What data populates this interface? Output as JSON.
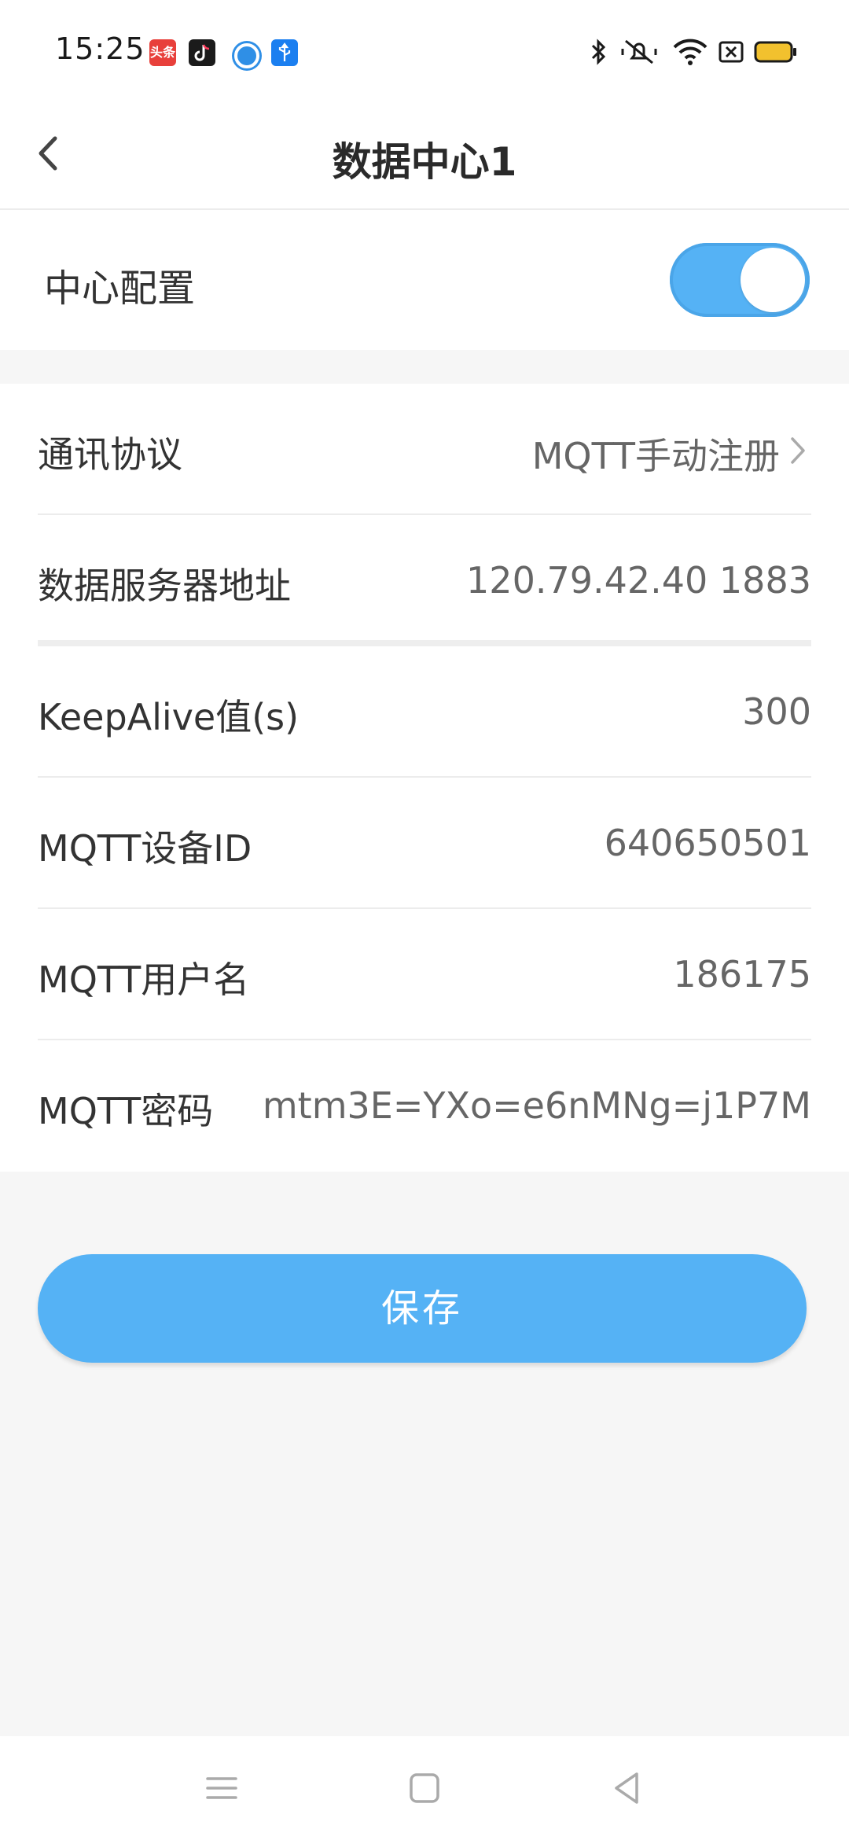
{
  "status_bar": {
    "time": "15:25",
    "notification_icons": [
      "toutiao-app-icon",
      "tiktok-app-icon",
      "circle-app-icon",
      "usb-icon"
    ],
    "status_icons": [
      "bluetooth-icon",
      "mute-icon",
      "wifi-icon",
      "sim-icon",
      "battery-icon"
    ],
    "toutiao_label": "头条"
  },
  "header": {
    "title": "数据中心1",
    "back_icon": "back-arrow-icon"
  },
  "config": {
    "label": "中心配置",
    "enabled": true,
    "accent_color": "#55b2f5"
  },
  "rows": [
    {
      "label": "通讯协议",
      "value": "MQTT手动注册",
      "has_chevron": true
    },
    {
      "label": "数据服务器地址",
      "value": "120.79.42.40 1883",
      "has_chevron": false
    },
    {
      "label": "KeepAlive值(s)",
      "value": "300",
      "has_chevron": false
    },
    {
      "label": "MQTT设备ID",
      "value": "640650501",
      "has_chevron": false
    },
    {
      "label": "MQTT用户名",
      "value": "186175",
      "has_chevron": false
    },
    {
      "label": "MQTT密码",
      "value": "mtm3E=YXo=e6nMNg=j1P7M",
      "has_chevron": false
    }
  ],
  "save_button": {
    "label": "保存"
  },
  "nav_bar": {
    "icons": [
      "menu-icon",
      "home-icon",
      "back-triangle-icon"
    ]
  }
}
